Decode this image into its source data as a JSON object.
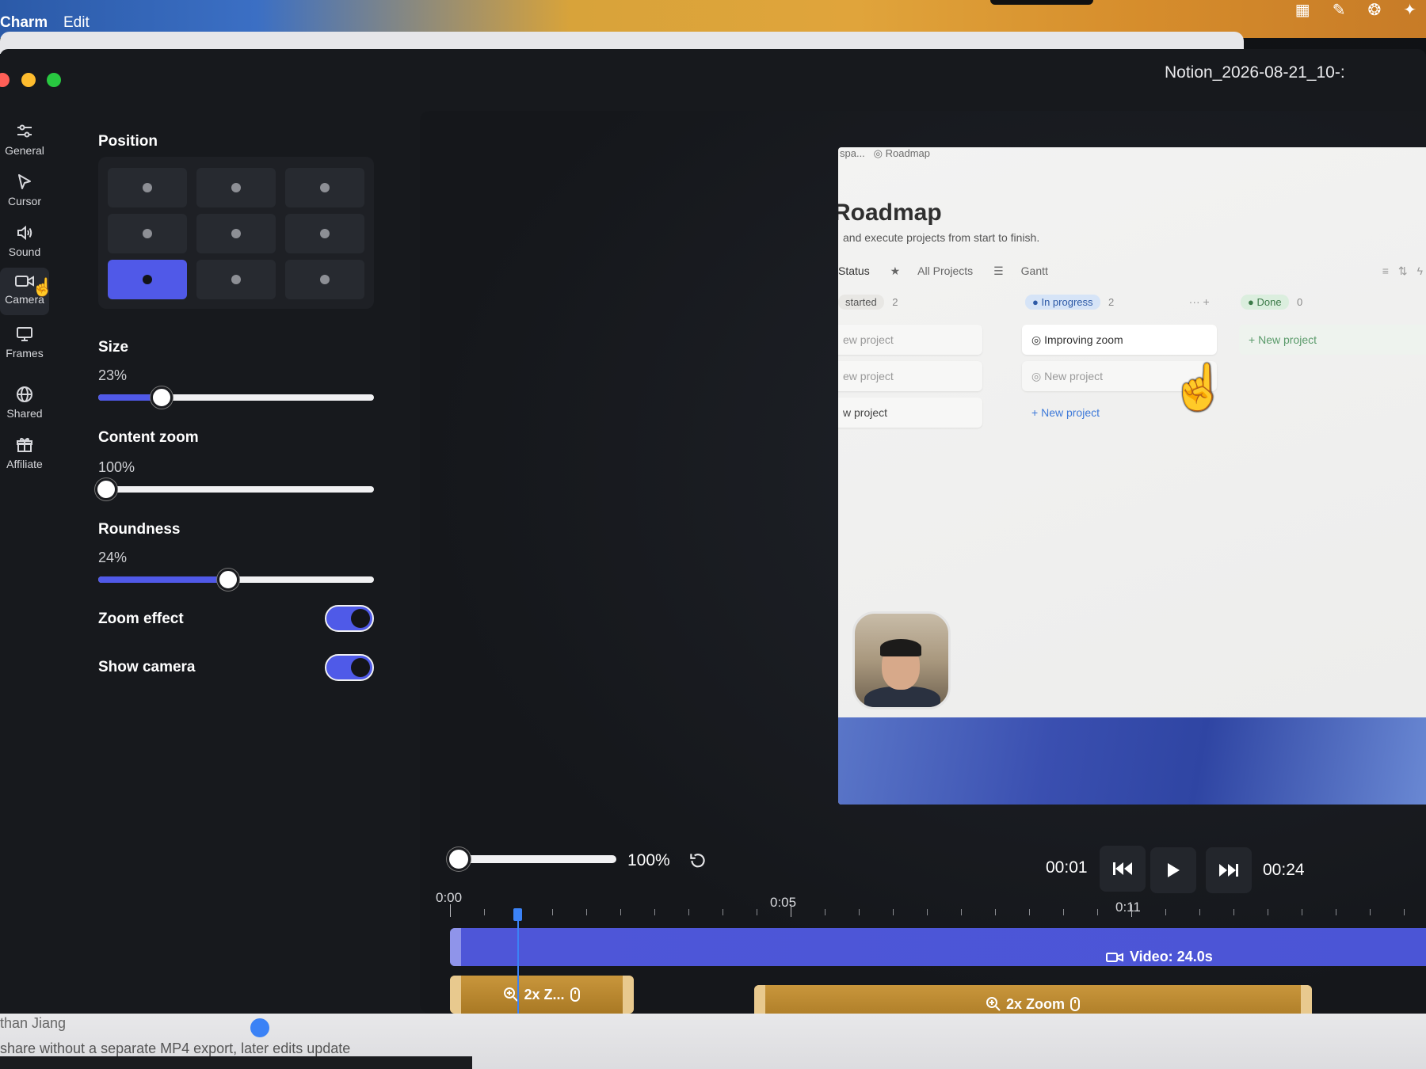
{
  "menubar": {
    "app_name": "Charm",
    "edit_label": "Edit"
  },
  "window": {
    "title": "Notion_2026-08-21_10-:"
  },
  "sidebar": {
    "items": [
      {
        "label": "General",
        "icon": "sliders-icon"
      },
      {
        "label": "Cursor",
        "icon": "cursor-icon"
      },
      {
        "label": "Sound",
        "icon": "speaker-icon"
      },
      {
        "label": "Camera",
        "icon": "video-camera-icon"
      },
      {
        "label": "Frames",
        "icon": "monitor-icon"
      },
      {
        "label": "Shared",
        "icon": "globe-icon"
      },
      {
        "label": "Affiliate",
        "icon": "gift-icon"
      }
    ],
    "active": "Camera"
  },
  "settings": {
    "position_title": "Position",
    "position_selected": "bottom-left",
    "size_title": "Size",
    "size_value": "23%",
    "size_level": 0.23,
    "content_zoom_title": "Content zoom",
    "content_zoom_value": "100%",
    "content_zoom_level": 0.0,
    "roundness_title": "Roundness",
    "roundness_value": "24%",
    "roundness_level": 0.47,
    "zoom_effect_label": "Zoom effect",
    "zoom_effect_on": true,
    "show_camera_label": "Show camera",
    "show_camera_on": true
  },
  "preview": {
    "breadcrumb_left": "spa...",
    "breadcrumb_page": "Roadmap",
    "page_title": "Roadmap",
    "page_subtitle": "and execute projects from start to finish.",
    "tabs": [
      "Status",
      "All Projects",
      "Gantt"
    ],
    "columns": {
      "not_started": {
        "label": "started",
        "count": "2",
        "cards": [
          "ew project",
          "ew project",
          "w project"
        ]
      },
      "in_progress": {
        "label": "In progress",
        "count": "2",
        "cards": [
          "Improving zoom",
          "New project"
        ],
        "add": "New project"
      },
      "done": {
        "label": "Done",
        "count": "0",
        "add": "New project"
      }
    }
  },
  "playback": {
    "zoom_percent": "100%",
    "current_time": "00:01",
    "total_time": "00:24"
  },
  "timeline": {
    "tick_labels": [
      "0:00",
      "0:05",
      "0:11"
    ],
    "video_label": "Video: 24.0s",
    "zoom_clips": [
      "2x Z...",
      "2x Zoom"
    ]
  },
  "background": {
    "author": "than Jiang",
    "line": "share without a separate MP4 export, later edits update"
  }
}
